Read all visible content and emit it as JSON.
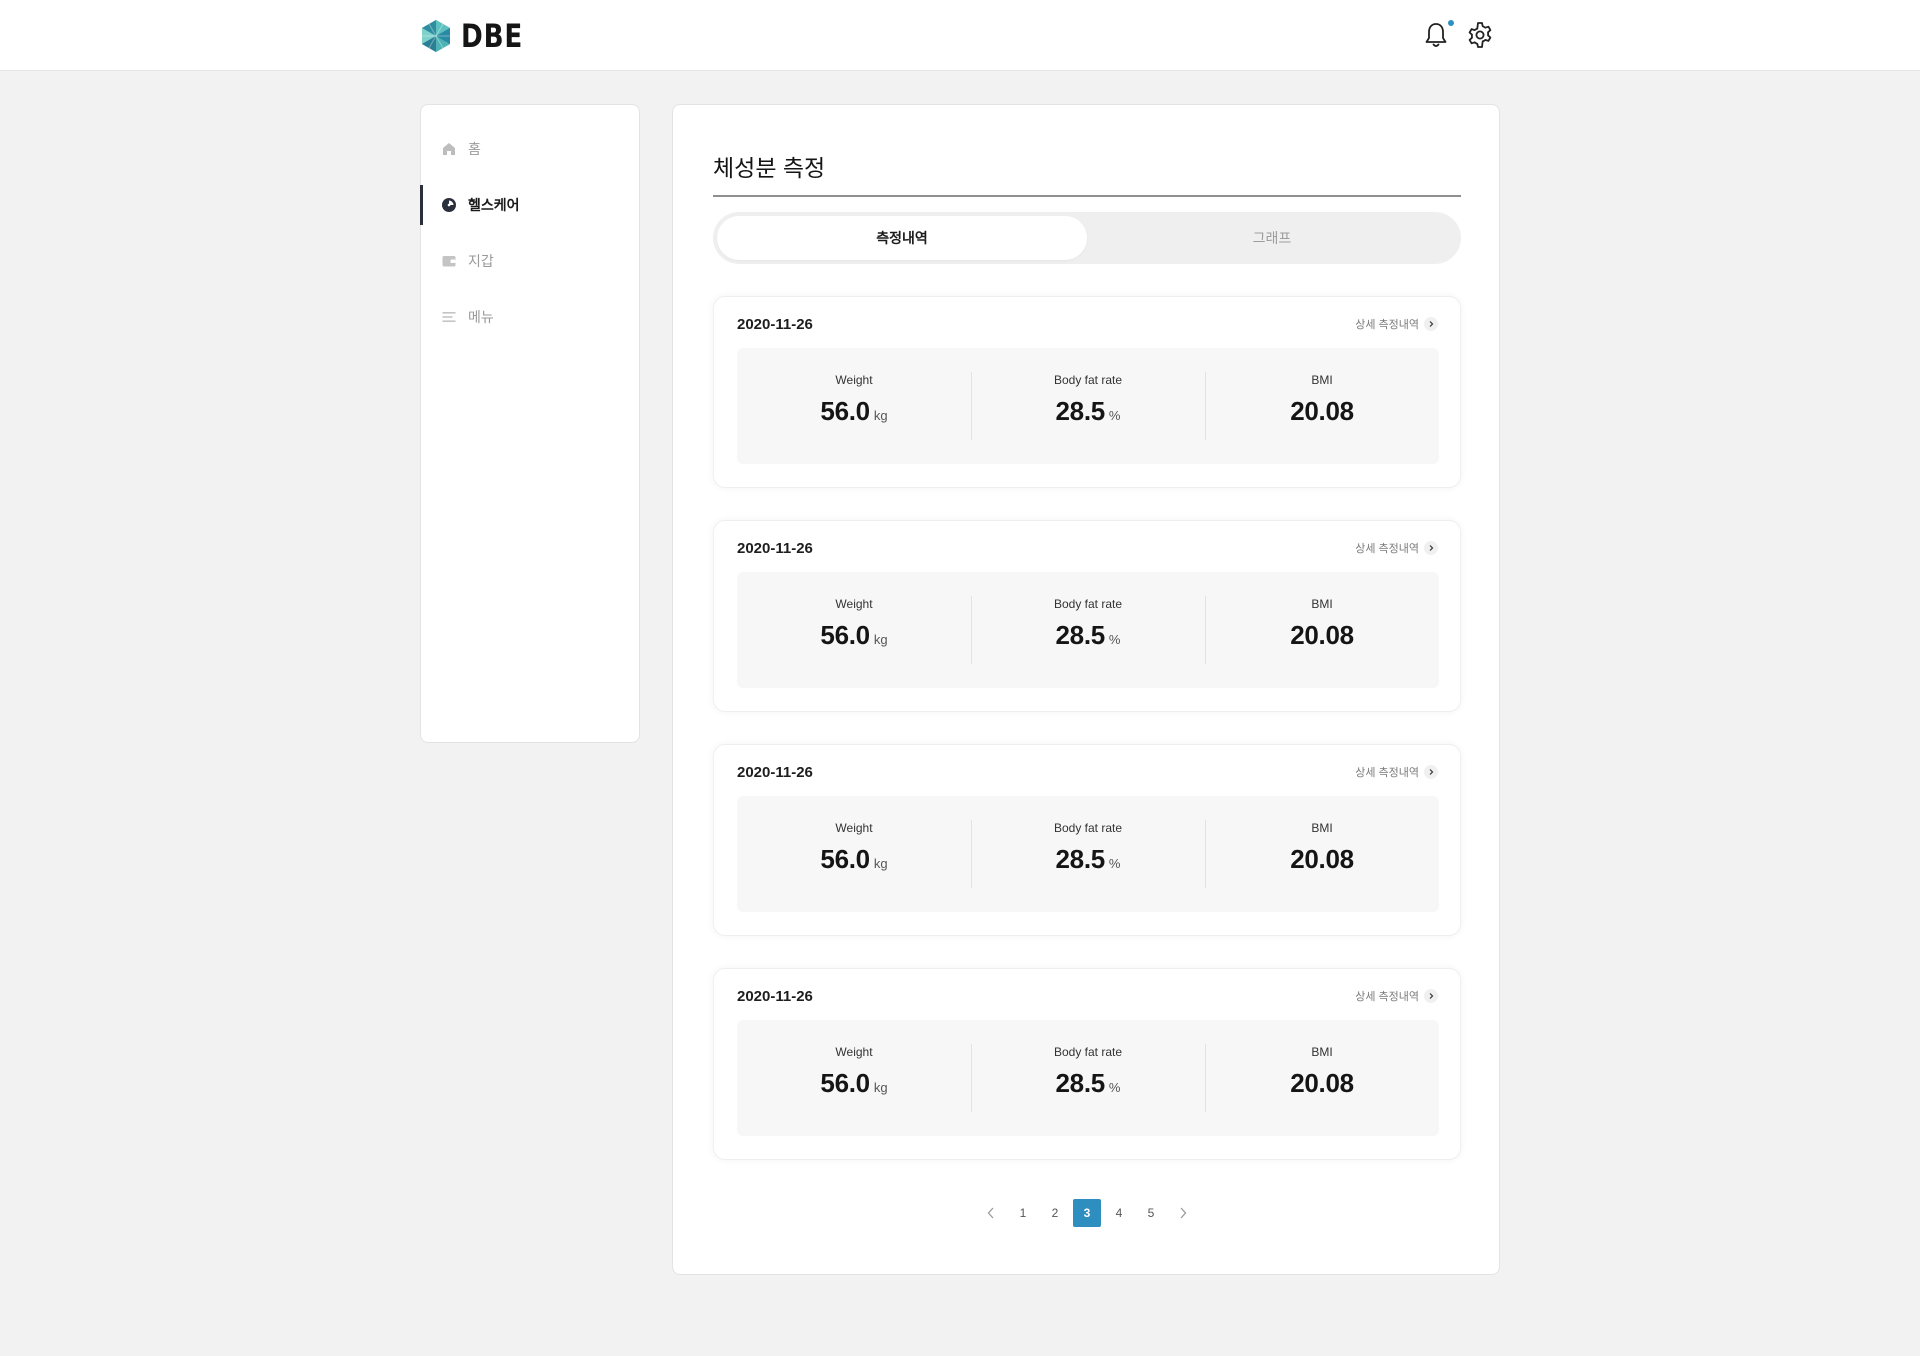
{
  "header": {
    "logo_text": "DBE",
    "accent_color": "#2e8ec0",
    "icons": [
      "bell-icon",
      "gear-icon"
    ],
    "has_notification": true
  },
  "sidebar": {
    "items": [
      {
        "label": "홈",
        "icon": "home-icon",
        "active": false
      },
      {
        "label": "헬스케어",
        "icon": "healthcare-icon",
        "active": true
      },
      {
        "label": "지갑",
        "icon": "wallet-icon",
        "active": false
      },
      {
        "label": "메뉴",
        "icon": "menu-icon",
        "active": false
      }
    ]
  },
  "main": {
    "title": "체성분 측정",
    "tabs": [
      {
        "label": "측정내역",
        "active": true
      },
      {
        "label": "그래프",
        "active": false
      }
    ],
    "records": [
      {
        "date": "2020-11-26",
        "detail_link": "상세 측정내역",
        "weight": {
          "label": "Weight",
          "value": "56.0",
          "unit": "kg"
        },
        "body_fat": {
          "label": "Body fat rate",
          "value": "28.5",
          "unit": "%"
        },
        "bmi": {
          "label": "BMI",
          "value": "20.08"
        }
      },
      {
        "date": "2020-11-26",
        "detail_link": "상세 측정내역",
        "weight": {
          "label": "Weight",
          "value": "56.0",
          "unit": "kg"
        },
        "body_fat": {
          "label": "Body fat rate",
          "value": "28.5",
          "unit": "%"
        },
        "bmi": {
          "label": "BMI",
          "value": "20.08"
        }
      },
      {
        "date": "2020-11-26",
        "detail_link": "상세 측정내역",
        "weight": {
          "label": "Weight",
          "value": "56.0",
          "unit": "kg"
        },
        "body_fat": {
          "label": "Body fat rate",
          "value": "28.5",
          "unit": "%"
        },
        "bmi": {
          "label": "BMI",
          "value": "20.08"
        }
      },
      {
        "date": "2020-11-26",
        "detail_link": "상세 측정내역",
        "weight": {
          "label": "Weight",
          "value": "56.0",
          "unit": "kg"
        },
        "body_fat": {
          "label": "Body fat rate",
          "value": "28.5",
          "unit": "%"
        },
        "bmi": {
          "label": "BMI",
          "value": "20.08"
        }
      }
    ],
    "pagination": {
      "pages": [
        "1",
        "2",
        "3",
        "4",
        "5"
      ],
      "current": "3",
      "prev_icon": "chevron-left-icon",
      "next_icon": "chevron-right-icon"
    }
  }
}
